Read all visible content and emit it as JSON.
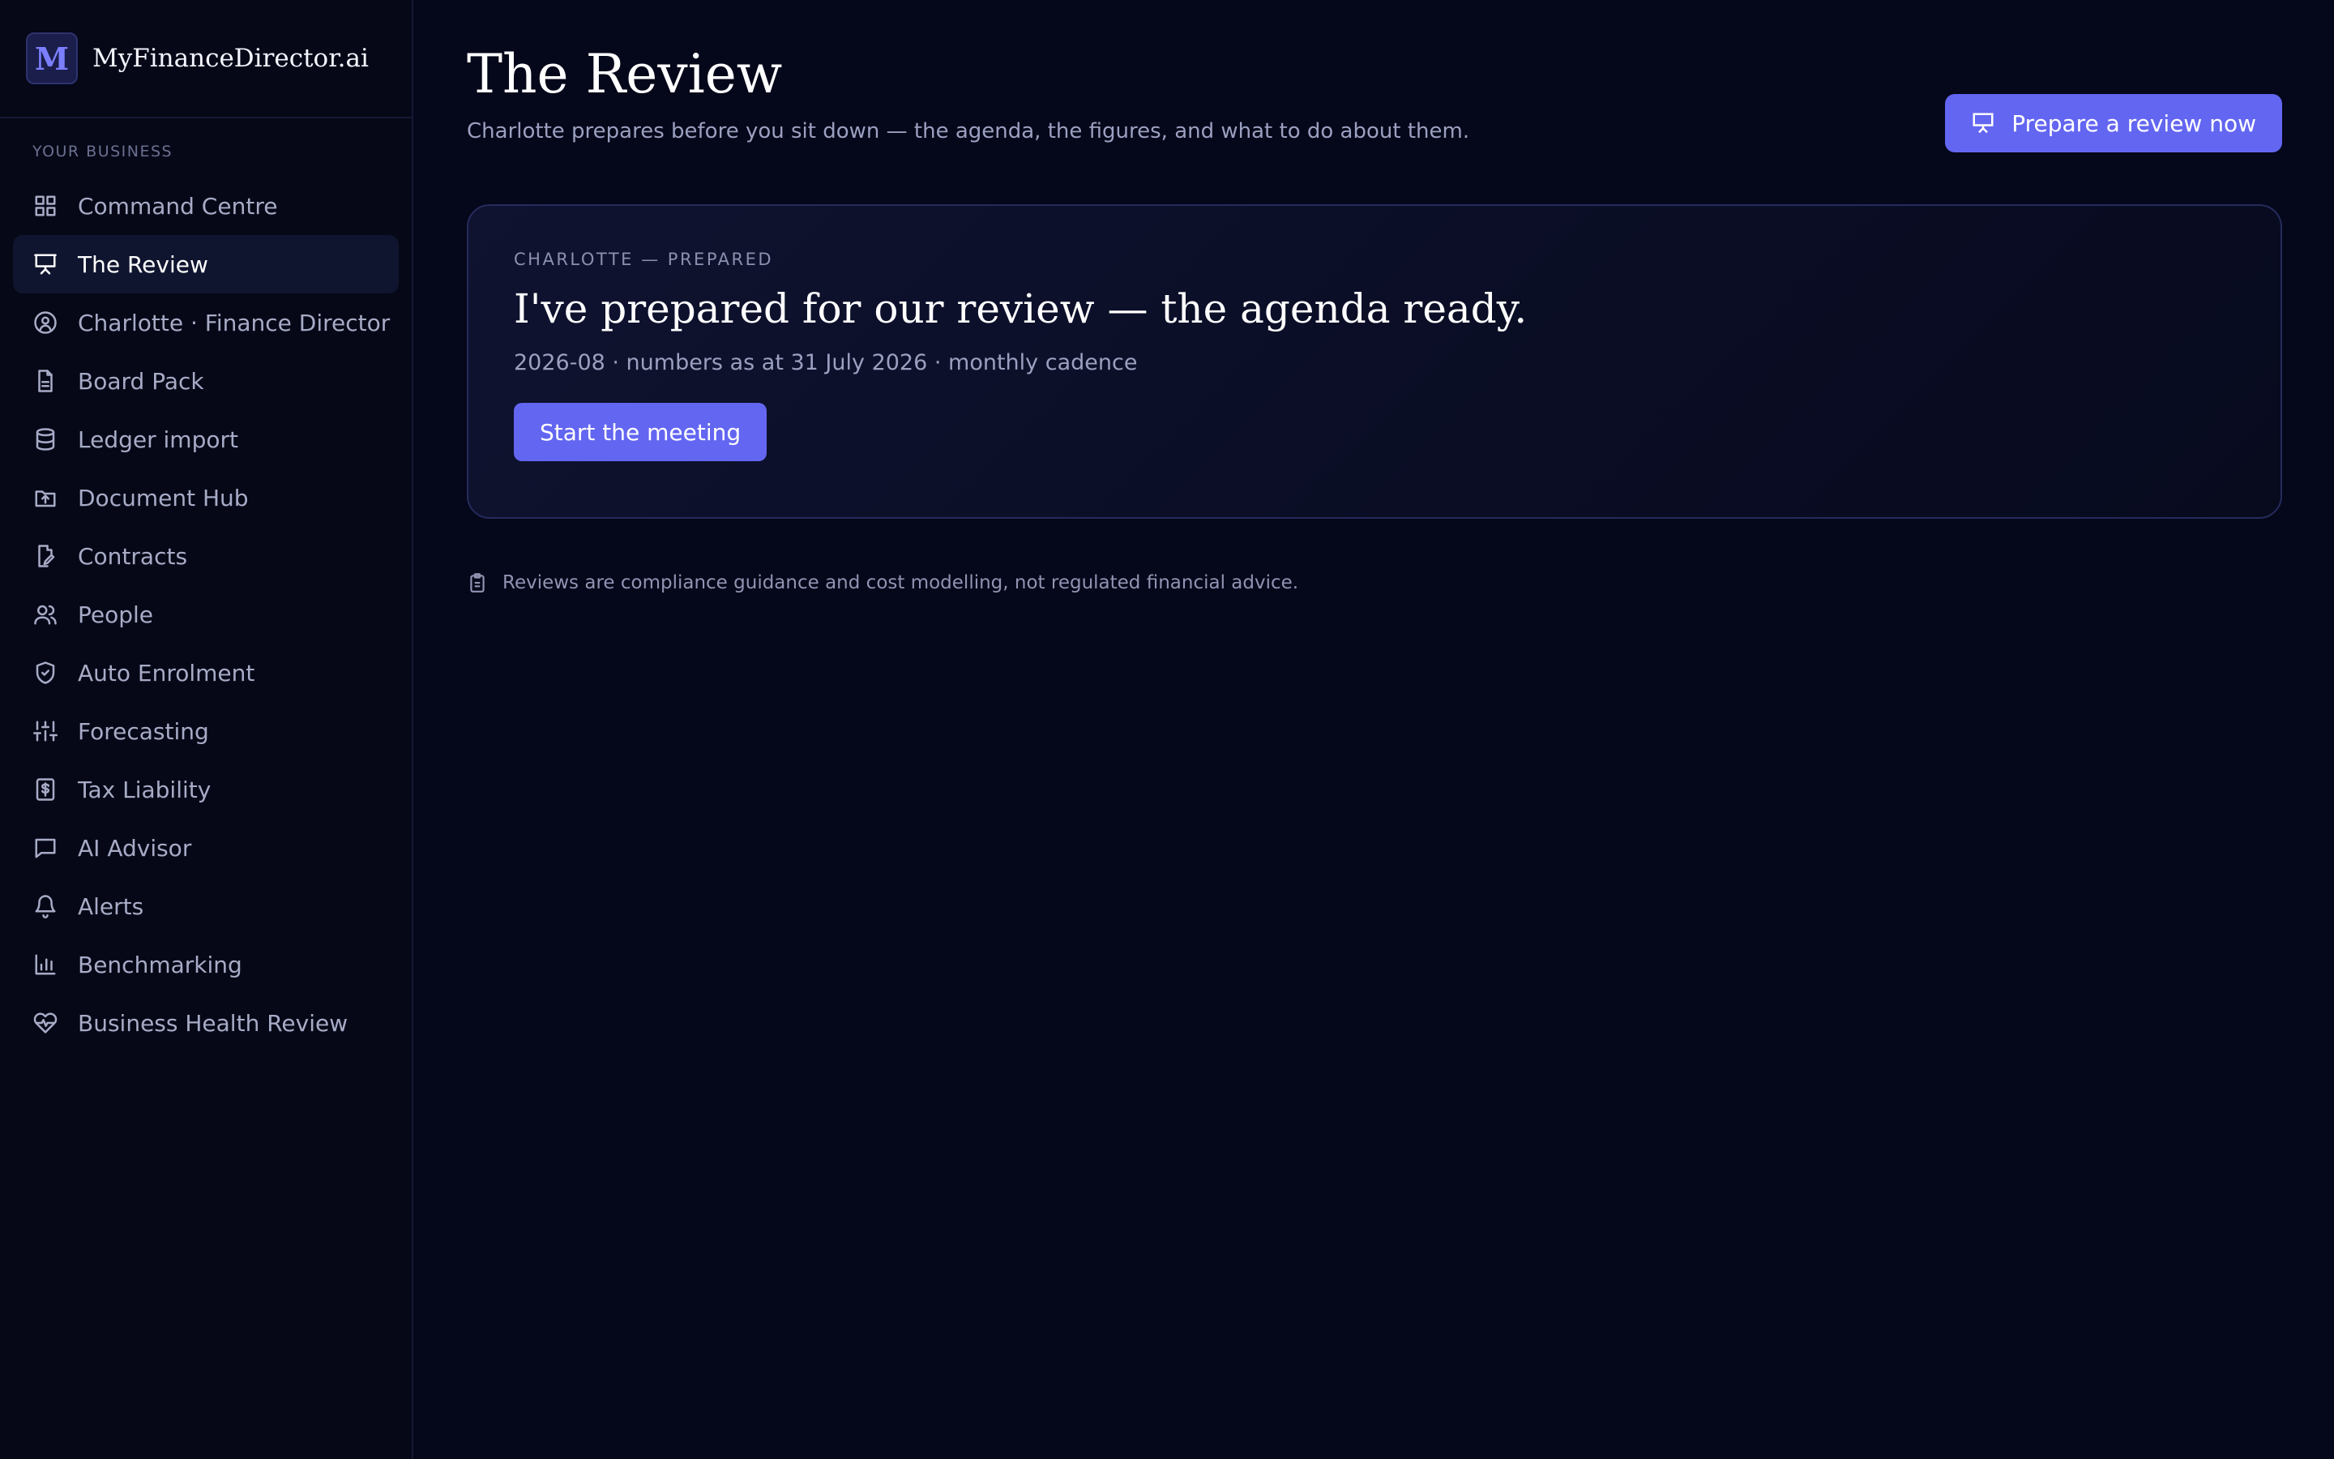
{
  "brand": {
    "logo_letter": "M",
    "name": "MyFinanceDirector.ai"
  },
  "sidebar": {
    "section_label": "YOUR BUSINESS",
    "items": [
      {
        "label": "Command Centre",
        "icon": "grid-icon",
        "active": false
      },
      {
        "label": "The Review",
        "icon": "presentation-icon",
        "active": true
      },
      {
        "label": "Charlotte · Finance Director",
        "icon": "user-circle-icon",
        "active": false
      },
      {
        "label": "Board Pack",
        "icon": "document-icon",
        "active": false
      },
      {
        "label": "Ledger import",
        "icon": "database-icon",
        "active": false
      },
      {
        "label": "Document Hub",
        "icon": "folder-upload-icon",
        "active": false
      },
      {
        "label": "Contracts",
        "icon": "file-edit-icon",
        "active": false
      },
      {
        "label": "People",
        "icon": "users-icon",
        "active": false
      },
      {
        "label": "Auto Enrolment",
        "icon": "shield-check-icon",
        "active": false
      },
      {
        "label": "Forecasting",
        "icon": "sliders-icon",
        "active": false
      },
      {
        "label": "Tax Liability",
        "icon": "receipt-icon",
        "active": false
      },
      {
        "label": "AI Advisor",
        "icon": "message-icon",
        "active": false
      },
      {
        "label": "Alerts",
        "icon": "bell-icon",
        "active": false
      },
      {
        "label": "Benchmarking",
        "icon": "bar-chart-icon",
        "active": false
      },
      {
        "label": "Business Health Review",
        "icon": "heart-pulse-icon",
        "active": false
      }
    ]
  },
  "header": {
    "title": "The Review",
    "subtitle": "Charlotte prepares before you sit down — the agenda, the figures, and what to do about them.",
    "action_label": "Prepare a review now"
  },
  "card": {
    "eyebrow": "CHARLOTTE — PREPARED",
    "title": "I've prepared for our review — the agenda ready.",
    "meta": "2026-08 · numbers as at 31 July 2026 · monthly cadence",
    "button_label": "Start the meeting"
  },
  "disclaimer": "Reviews are compliance guidance and cost modelling, not regulated financial advice.",
  "colors": {
    "accent": "#6366f1",
    "background": "#05071a",
    "sidebar": "#060817"
  }
}
